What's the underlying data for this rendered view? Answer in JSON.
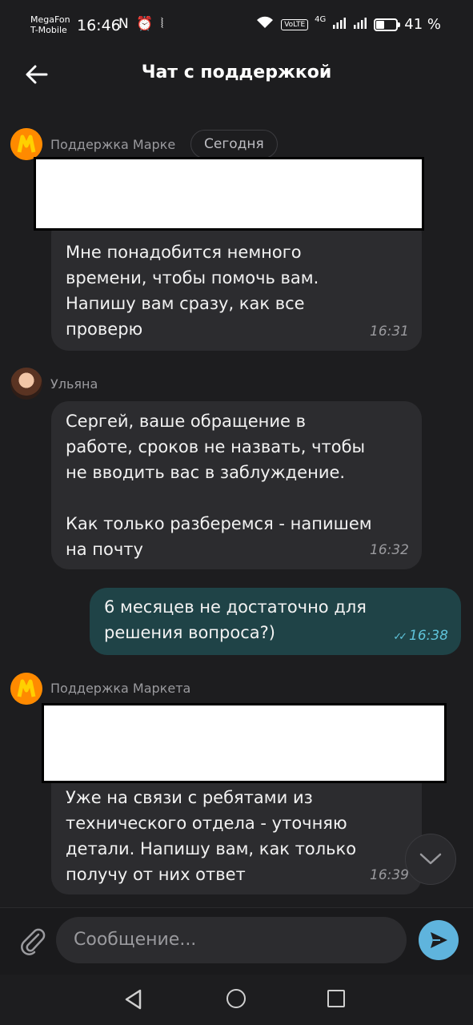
{
  "status_bar": {
    "carrier_1": "MegaFon",
    "carrier_2": "T-Mobile",
    "time": "16:46",
    "left_icons": "N ⏰ ⦚",
    "volte": "VoLTE",
    "network": "4G",
    "battery": "41 %",
    "battery_level": 0.41
  },
  "header": {
    "title": "Чат с поддержкой",
    "back_icon": "arrow-left-icon"
  },
  "date_pill": "Сегодня",
  "messages": [
    {
      "sender": "Поддержка Марке",
      "text": "Мне понадобится немного\nвремени, чтобы помочь вам.\nНапишу вам сразу, как все\nпроверю",
      "time": "16:31"
    },
    {
      "sender": "Ульяна",
      "text": "Сергей, ваше обращение в\nработе, сроков не назвать, чтобы\nне вводить вас в заблуждение.\n\nКак только разберемся - напишем\nна почту",
      "time": "16:32"
    },
    {
      "text": "6 месяцев не достаточно для\nрешения вопроса?)",
      "time": "16:38",
      "status": "✓✓"
    },
    {
      "sender": "Поддержка Маркета",
      "text": "Уже на связи с ребятами из\nтехнического отдела - уточняю\nдетали. Напишу вам, как только\nполучу от них ответ",
      "time": "16:39"
    }
  ],
  "composer": {
    "placeholder": "Сообщение..."
  },
  "colors": {
    "background": "#1d1d1f",
    "bubble_in": "#2c2c2f",
    "bubble_out": "#1f4347",
    "accent": "#5fb4dd",
    "brand": "#ff8a00"
  }
}
